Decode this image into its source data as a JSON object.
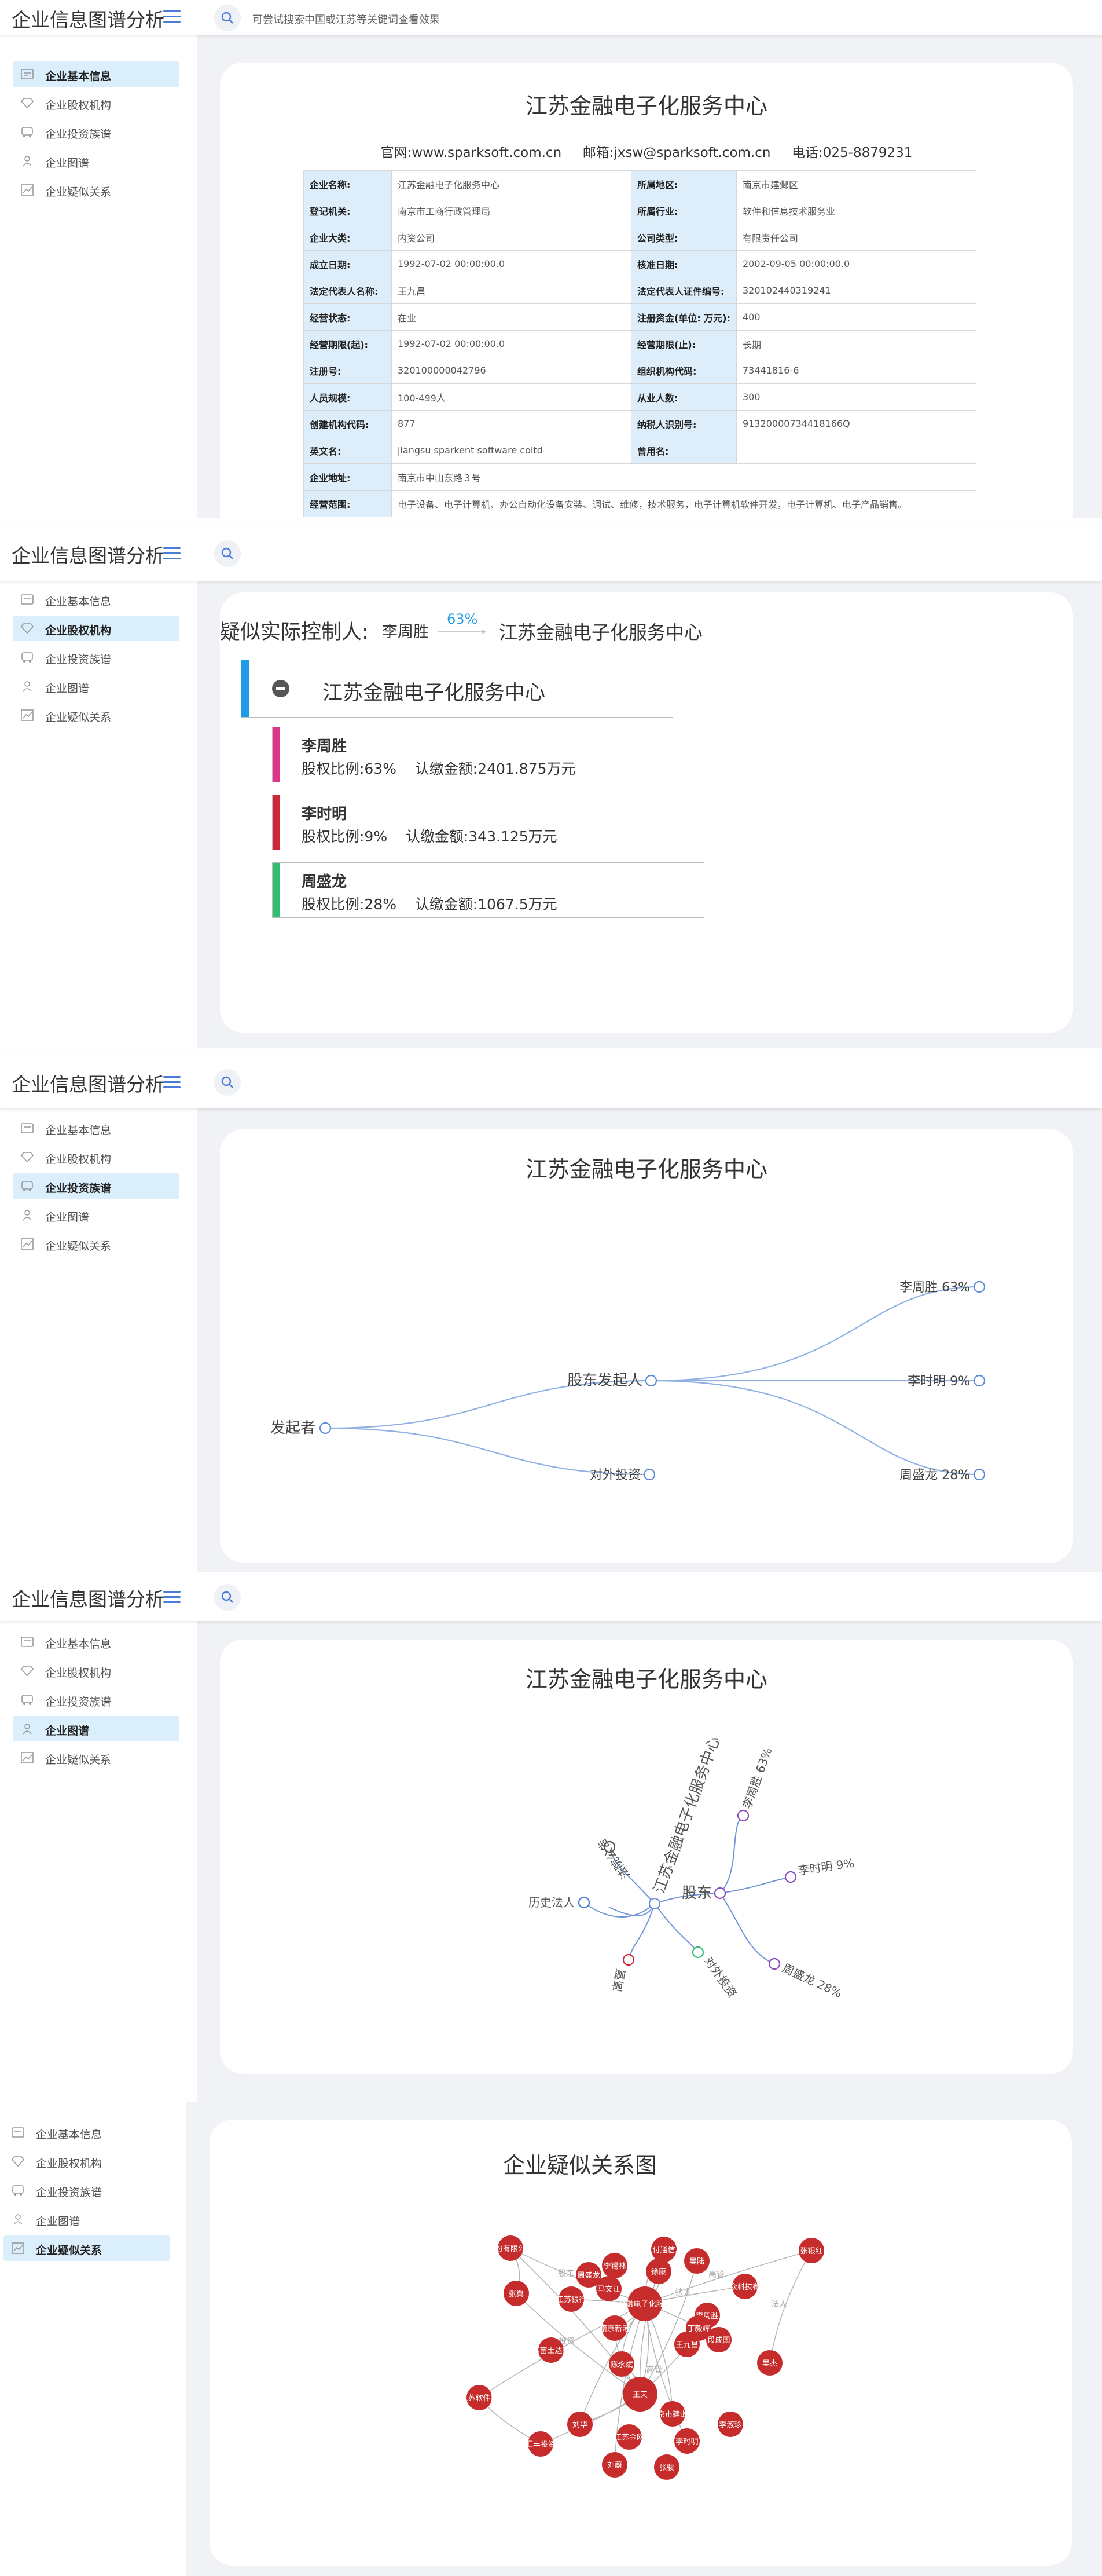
{
  "app": {
    "title": "企业信息图谱分析",
    "search_hint": "可尝试搜索中国或江苏等关键词查看效果"
  },
  "sidebar": {
    "items": [
      {
        "label": "企业基本信息",
        "icon": "id-card-icon"
      },
      {
        "label": "企业股权机构",
        "icon": "diamond-icon"
      },
      {
        "label": "企业投资族谱",
        "icon": "bus-icon"
      },
      {
        "label": "企业图谱",
        "icon": "person-icon"
      },
      {
        "label": "企业疑似关系",
        "icon": "chart-icon"
      }
    ]
  },
  "company": {
    "name": "江苏金融电子化服务中心",
    "website": "官网:www.sparksoft.com.cn",
    "email": "邮箱:jxsw@sparksoft.com.cn",
    "phone": "电话:025-8879231"
  },
  "info_table": [
    [
      "企业名称:",
      "江苏金融电子化服务中心",
      "所属地区:",
      "南京市建邺区"
    ],
    [
      "登记机关:",
      "南京市工商行政管理局",
      "所属行业:",
      "软件和信息技术服务业"
    ],
    [
      "企业大类:",
      "内资公司",
      "公司类型:",
      "有限责任公司"
    ],
    [
      "成立日期:",
      "1992-07-02 00:00:00.0",
      "核准日期:",
      "2002-09-05 00:00:00.0"
    ],
    [
      "法定代表人名称:",
      "王九昌",
      "法定代表人证件编号:",
      "320102440319241"
    ],
    [
      "经营状态:",
      "在业",
      "注册资金(单位: 万元):",
      "400"
    ],
    [
      "经营期限(起):",
      "1992-07-02 00:00:00.0",
      "经营期限(止):",
      "长期"
    ],
    [
      "注册号:",
      "320100000042796",
      "组织机构代码:",
      "73441816-6"
    ],
    [
      "人员规模:",
      "100-499人",
      "从业人数:",
      "300"
    ],
    [
      "创建机构代码:",
      "877",
      "纳税人识别号:",
      "91320000734418166Q"
    ],
    [
      "英文名:",
      "jiangsu sparkent software coltd",
      "曾用名:",
      ""
    ],
    [
      "企业地址:",
      "南京市中山东路３号"
    ],
    [
      "经营范围:",
      "电子设备、电子计算机、办公自动化设备安装、调试、维修，技术服务，电子计算机软件开发，电子计算机、电子产品销售。"
    ]
  ],
  "controller": {
    "label": "疑似实际控制人:",
    "person": "李周胜",
    "percent": "63%",
    "company": "江苏金融电子化服务中心"
  },
  "shareholders": [
    {
      "name": "李周胜",
      "detail": "股权比例:63%    认缴金额:2401.875万元",
      "color": "#e0338a"
    },
    {
      "name": "李时明",
      "detail": "股权比例:9%    认缴金额:343.125万元",
      "color": "#d1263a"
    },
    {
      "name": "周盛龙",
      "detail": "股权比例:28%    认缴金额:1067.5万元",
      "color": "#2fbf71"
    }
  ],
  "investment_tree": {
    "title": "江苏金融电子化服务中心",
    "root": "发起者",
    "mid_nodes": [
      "股东发起人",
      "对外投资"
    ],
    "leaves": [
      "李周胜 63%",
      "李时明 9%",
      "周盛龙 28%"
    ]
  },
  "graph": {
    "title": "江苏金融电子化服务中心",
    "center": "江苏金融电子化服务中心",
    "nodes": [
      "法院公告",
      "历史法人",
      "高管",
      "对外投资",
      "股东",
      "李周胜 63%",
      "李时明 9%",
      "周盛龙 28%"
    ]
  },
  "relations": {
    "title": "企业疑似关系图",
    "node_labels": [
      "苏州银行股份有限公司苏州分行",
      "李锡林",
      "江苏汇付通信息技术",
      "吴陆",
      "张银红",
      "周盛龙",
      "徐康",
      "马文江",
      "江苏金融电子化服务中心",
      "李周胜",
      "江苏汇众科技有限公司",
      "丁毅辉",
      "南京新港",
      "王九昌",
      "段成国",
      "张翼",
      "江苏银行",
      "江苏富士达科技",
      "陈永斌",
      "吴杰",
      "江苏软件园",
      "王天",
      "南京市建邺区",
      "李淑珍",
      "刘华",
      "江苏金网",
      "李时明",
      "汇丰投资",
      "刘蔚",
      "张骏"
    ],
    "edge_labels": [
      "股东",
      "高管",
      "法人",
      "投资"
    ]
  },
  "colors": {
    "accent": "#4a7bd6",
    "node_red": "#c62c2c",
    "active_bg": "#dbeefb",
    "key_bg": "#ddeefa",
    "page_bg": "#f0f2f5"
  }
}
